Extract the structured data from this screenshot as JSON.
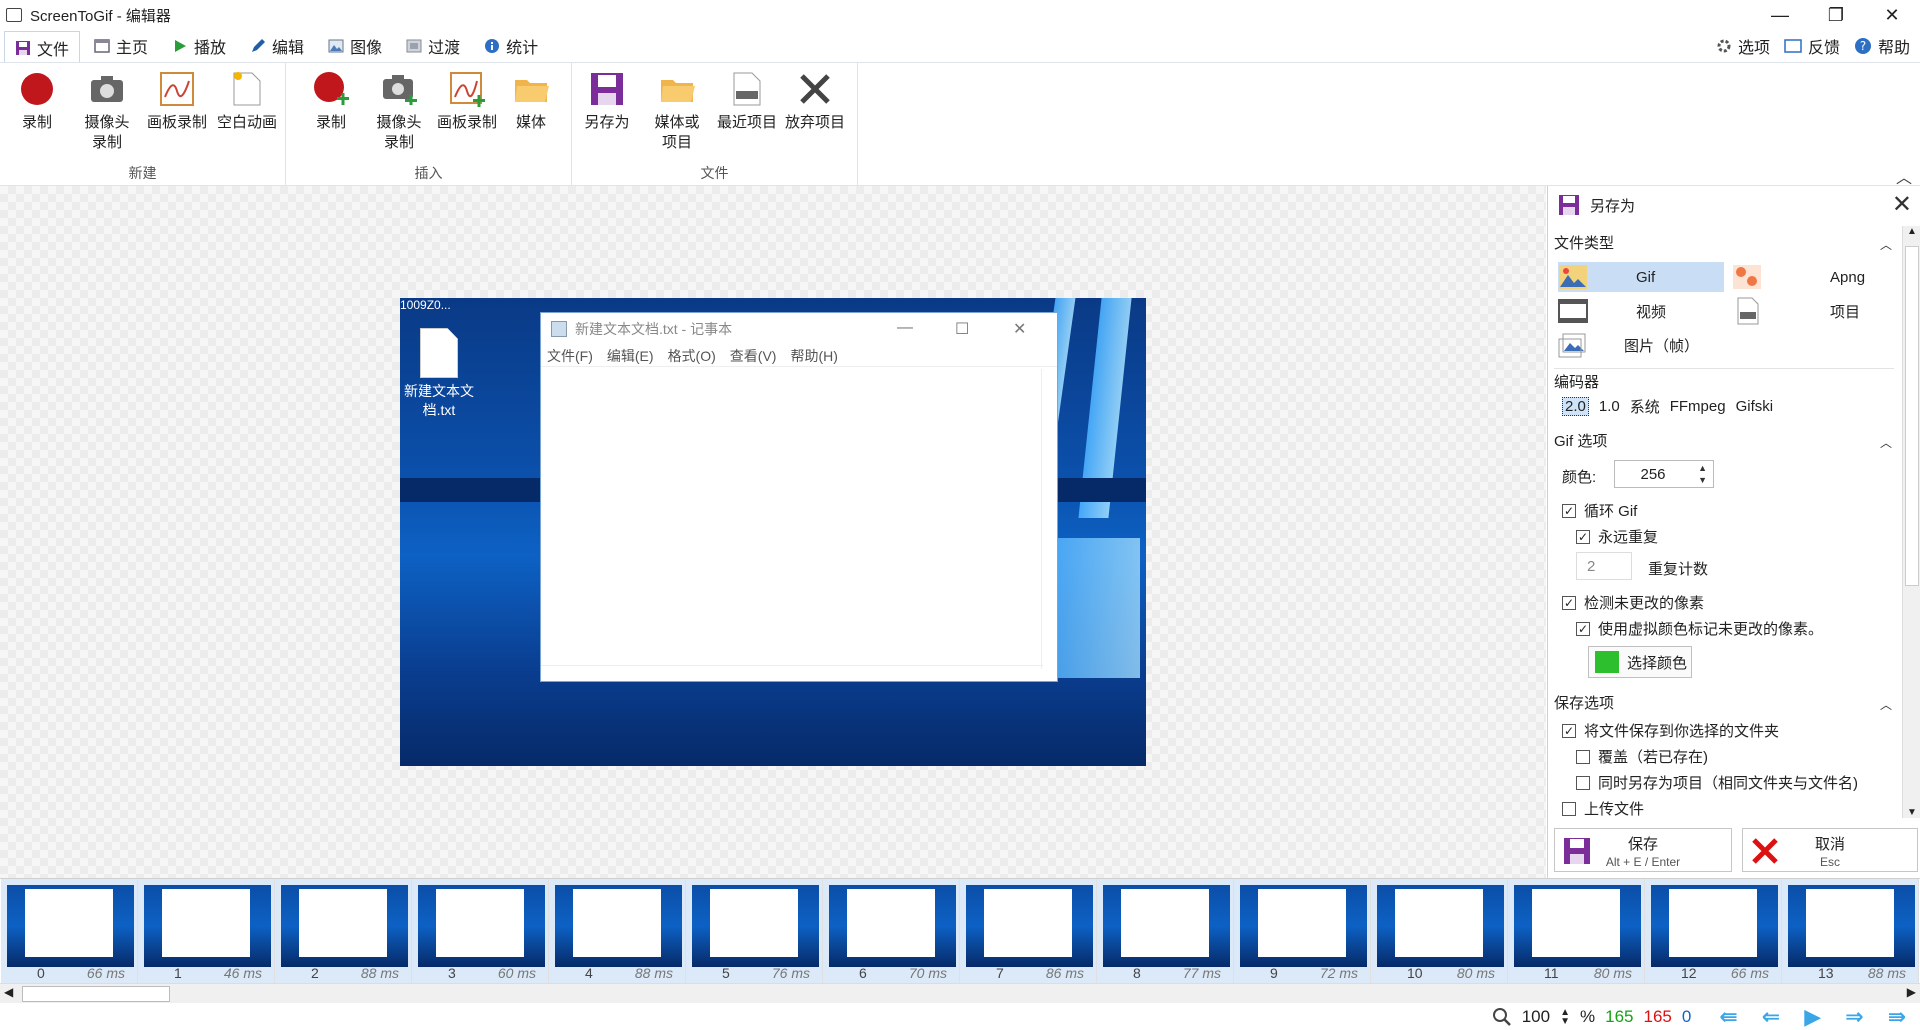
{
  "window": {
    "title": "ScreenToGif - 编辑器",
    "minimize": "—",
    "maximize": "❐",
    "close": "✕"
  },
  "tabs": [
    {
      "label": "文件",
      "icon": "save-icon"
    },
    {
      "label": "主页",
      "icon": "home-icon"
    },
    {
      "label": "播放",
      "icon": "play-icon"
    },
    {
      "label": "编辑",
      "icon": "pencil-icon"
    },
    {
      "label": "图像",
      "icon": "image-icon"
    },
    {
      "label": "过渡",
      "icon": "transition-icon"
    },
    {
      "label": "统计",
      "icon": "info-icon"
    }
  ],
  "top_links": {
    "options": "选项",
    "feedback": "反馈",
    "help": "帮助"
  },
  "ribbon": {
    "groups": {
      "new": "新建",
      "insert": "插入",
      "file": "文件"
    },
    "new": {
      "record": "录制",
      "webcam": "摄像头\n录制",
      "board": "画板录制",
      "blank": "空白动画"
    },
    "insert": {
      "record": "录制",
      "webcam": "摄像头\n录制",
      "board": "画板录制",
      "media": "媒体"
    },
    "file": {
      "save_as": "另存为",
      "media_project": "媒体或\n项目",
      "recent": "最近项目",
      "discard": "放弃项目"
    }
  },
  "preview": {
    "desktop_icon_top": "1009Z0...",
    "desktop_icon_label": "新建文本文\n档.txt",
    "notepad_title": "新建文本文档.txt - 记事本",
    "notepad_menu": [
      "文件(F)",
      "编辑(E)",
      "格式(O)",
      "查看(V)",
      "帮助(H)"
    ]
  },
  "panel": {
    "title": "另存为",
    "file_type_header": "文件类型",
    "file_types": [
      {
        "label": "Gif",
        "selected": true
      },
      {
        "label": "Apng",
        "selected": false
      },
      {
        "label": "视频",
        "selected": false
      },
      {
        "label": "项目",
        "selected": false
      },
      {
        "label": "图片（帧）",
        "selected": false
      }
    ],
    "encoder_header": "编码器",
    "encoders": [
      "2.0",
      "1.0",
      "系统",
      "FFmpeg",
      "Gifski"
    ],
    "encoder_selected": "2.0",
    "gif_options_header": "Gif 选项",
    "colors_label": "颜色:",
    "colors_value": "256",
    "loop_gif": "循环 Gif",
    "repeat_forever": "永远重复",
    "repeat_count_value": "2",
    "repeat_count_label": "重复计数",
    "detect_unchanged": "检测未更改的像素",
    "use_dummy_color": "使用虚拟颜色标记未更改的像素。",
    "pick_color": "选择颜色",
    "dummy_color": "#2dbf2d",
    "save_options_header": "保存选项",
    "save_to_folder": "将文件保存到你选择的文件夹",
    "overwrite": "覆盖（若已存在)",
    "save_as_project": "同时另存为项目（相同文件夹与文件名)",
    "upload": "上传文件",
    "save_button": "保存",
    "save_shortcut": "Alt + E / Enter",
    "cancel_button": "取消",
    "cancel_shortcut": "Esc"
  },
  "frames": [
    {
      "n": "0",
      "ms": "66 ms"
    },
    {
      "n": "1",
      "ms": "46 ms"
    },
    {
      "n": "2",
      "ms": "88 ms"
    },
    {
      "n": "3",
      "ms": "60 ms"
    },
    {
      "n": "4",
      "ms": "88 ms"
    },
    {
      "n": "5",
      "ms": "76 ms"
    },
    {
      "n": "6",
      "ms": "70 ms"
    },
    {
      "n": "7",
      "ms": "86 ms"
    },
    {
      "n": "8",
      "ms": "77 ms"
    },
    {
      "n": "9",
      "ms": "72 ms"
    },
    {
      "n": "10",
      "ms": "80 ms"
    },
    {
      "n": "11",
      "ms": "80 ms"
    },
    {
      "n": "12",
      "ms": "66 ms"
    },
    {
      "n": "13",
      "ms": "88 ms"
    }
  ],
  "status": {
    "zoom": "100",
    "percent": "%",
    "count_green": "165",
    "count_red": "165",
    "count_blue": "0"
  },
  "colors": {
    "accent": "#3aa6e8",
    "green": "#16a316",
    "red": "#d11",
    "blue": "#1565c0"
  }
}
